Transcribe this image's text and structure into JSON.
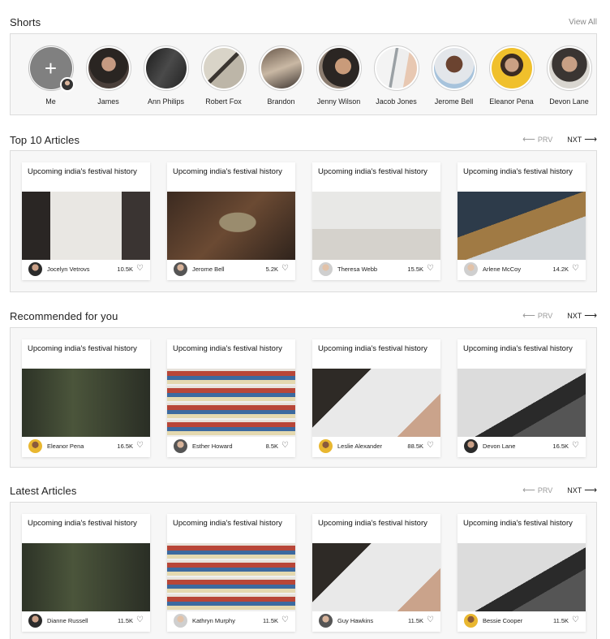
{
  "shorts": {
    "title": "Shorts",
    "view_all": "View All",
    "items": [
      {
        "name": "Me"
      },
      {
        "name": "James"
      },
      {
        "name": "Ann Philips"
      },
      {
        "name": "Robert Fox"
      },
      {
        "name": "Brandon"
      },
      {
        "name": "Jenny Wilson"
      },
      {
        "name": "Jacob Jones"
      },
      {
        "name": "Jerome Bell"
      },
      {
        "name": "Eleanor Pena"
      },
      {
        "name": "Devon Lane"
      }
    ]
  },
  "pager": {
    "prev": "PRV",
    "next": "NXT"
  },
  "sections": [
    {
      "title": "Top 10 Articles",
      "cards": [
        {
          "title": "Upcoming india's festival history",
          "author": "Jocelyn Vetrovs",
          "likes": "10.5K"
        },
        {
          "title": "Upcoming india's festival history",
          "author": "Jerome Bell",
          "likes": "5.2K"
        },
        {
          "title": "Upcoming india's festival history",
          "author": "Theresa Webb",
          "likes": "15.5K"
        },
        {
          "title": "Upcoming india's festival history",
          "author": "Arlene McCoy",
          "likes": "14.2K"
        }
      ]
    },
    {
      "title": "Recommended for you",
      "cards": [
        {
          "title": "Upcoming india's festival history",
          "author": "Eleanor Pena",
          "likes": "16.5K"
        },
        {
          "title": "Upcoming india's festival history",
          "author": "Esther Howard",
          "likes": "8.5K"
        },
        {
          "title": "Upcoming india's festival history",
          "author": "Leslie Alexander",
          "likes": "88.5K"
        },
        {
          "title": "Upcoming india's festival history",
          "author": "Devon Lane",
          "likes": "16.5K"
        }
      ]
    },
    {
      "title": "Latest Articles",
      "cards": [
        {
          "title": "Upcoming india's festival history",
          "author": "Dianne Russell",
          "likes": "11.5K"
        },
        {
          "title": "Upcoming india's festival history",
          "author": "Kathryn Murphy",
          "likes": "11.5K"
        },
        {
          "title": "Upcoming india's festival history",
          "author": "Guy Hawkins",
          "likes": "11.5K"
        },
        {
          "title": "Upcoming india's festival history",
          "author": "Bessie Cooper",
          "likes": "11.5K"
        }
      ]
    }
  ],
  "icons": {
    "add": "plus-icon",
    "like": "heart-icon",
    "prev": "arrow-left-icon",
    "next": "arrow-right-icon"
  }
}
